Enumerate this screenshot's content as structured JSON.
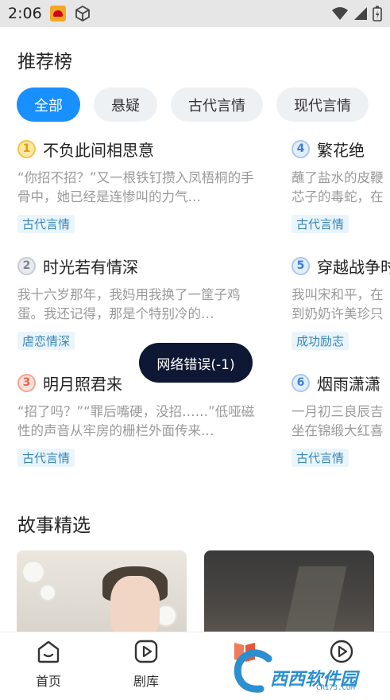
{
  "status_bar": {
    "time": "2:06"
  },
  "ranking": {
    "title": "推荐榜",
    "chips": [
      "全部",
      "悬疑",
      "古代言情",
      "现代言情"
    ],
    "items": [
      {
        "rank": "1",
        "title": "不负此间相思意",
        "desc": "“你招不招？”又一根铁钉攒入凤梧桐的手骨中，她已经是连惨叫的力气…",
        "tag": "古代言情"
      },
      {
        "rank": "2",
        "title": "时光若有情深",
        "desc": "我十六岁那年，我妈用我换了一筐子鸡蛋。我还记得，那是个特别冷的…",
        "tag": "虐恋情深"
      },
      {
        "rank": "3",
        "title": "明月照君来",
        "desc": "“招了吗？”“罪后嘴硬，没招……”低哑磁性的声音从牢房的栅栏外面传来…",
        "tag": "古代言情"
      },
      {
        "rank": "4",
        "title": "繁花绝",
        "desc": "蘸了盐水的皮鞭芯子的毒蛇，在",
        "tag": "古代言情"
      },
      {
        "rank": "5",
        "title": "穿越战争时",
        "desc": "我叫宋和平，在到奶奶许美珍只",
        "tag": "成功励志"
      },
      {
        "rank": "6",
        "title": "烟雨潇潇",
        "desc": "一月初三良辰吉坐在锦缎大红喜",
        "tag": "古代言情"
      }
    ]
  },
  "toast": {
    "text": "网络错误(-1)"
  },
  "stories": {
    "title": "故事精选"
  },
  "bottom_nav": {
    "items": [
      {
        "label": "首页",
        "icon": "home-icon"
      },
      {
        "label": "剧库",
        "icon": "play-icon"
      },
      {
        "label": "",
        "icon": "book-icon"
      },
      {
        "label": "",
        "icon": "video-icon"
      }
    ]
  },
  "watermark": {
    "text": "西西软件园",
    "sub": "CR173.COM"
  }
}
